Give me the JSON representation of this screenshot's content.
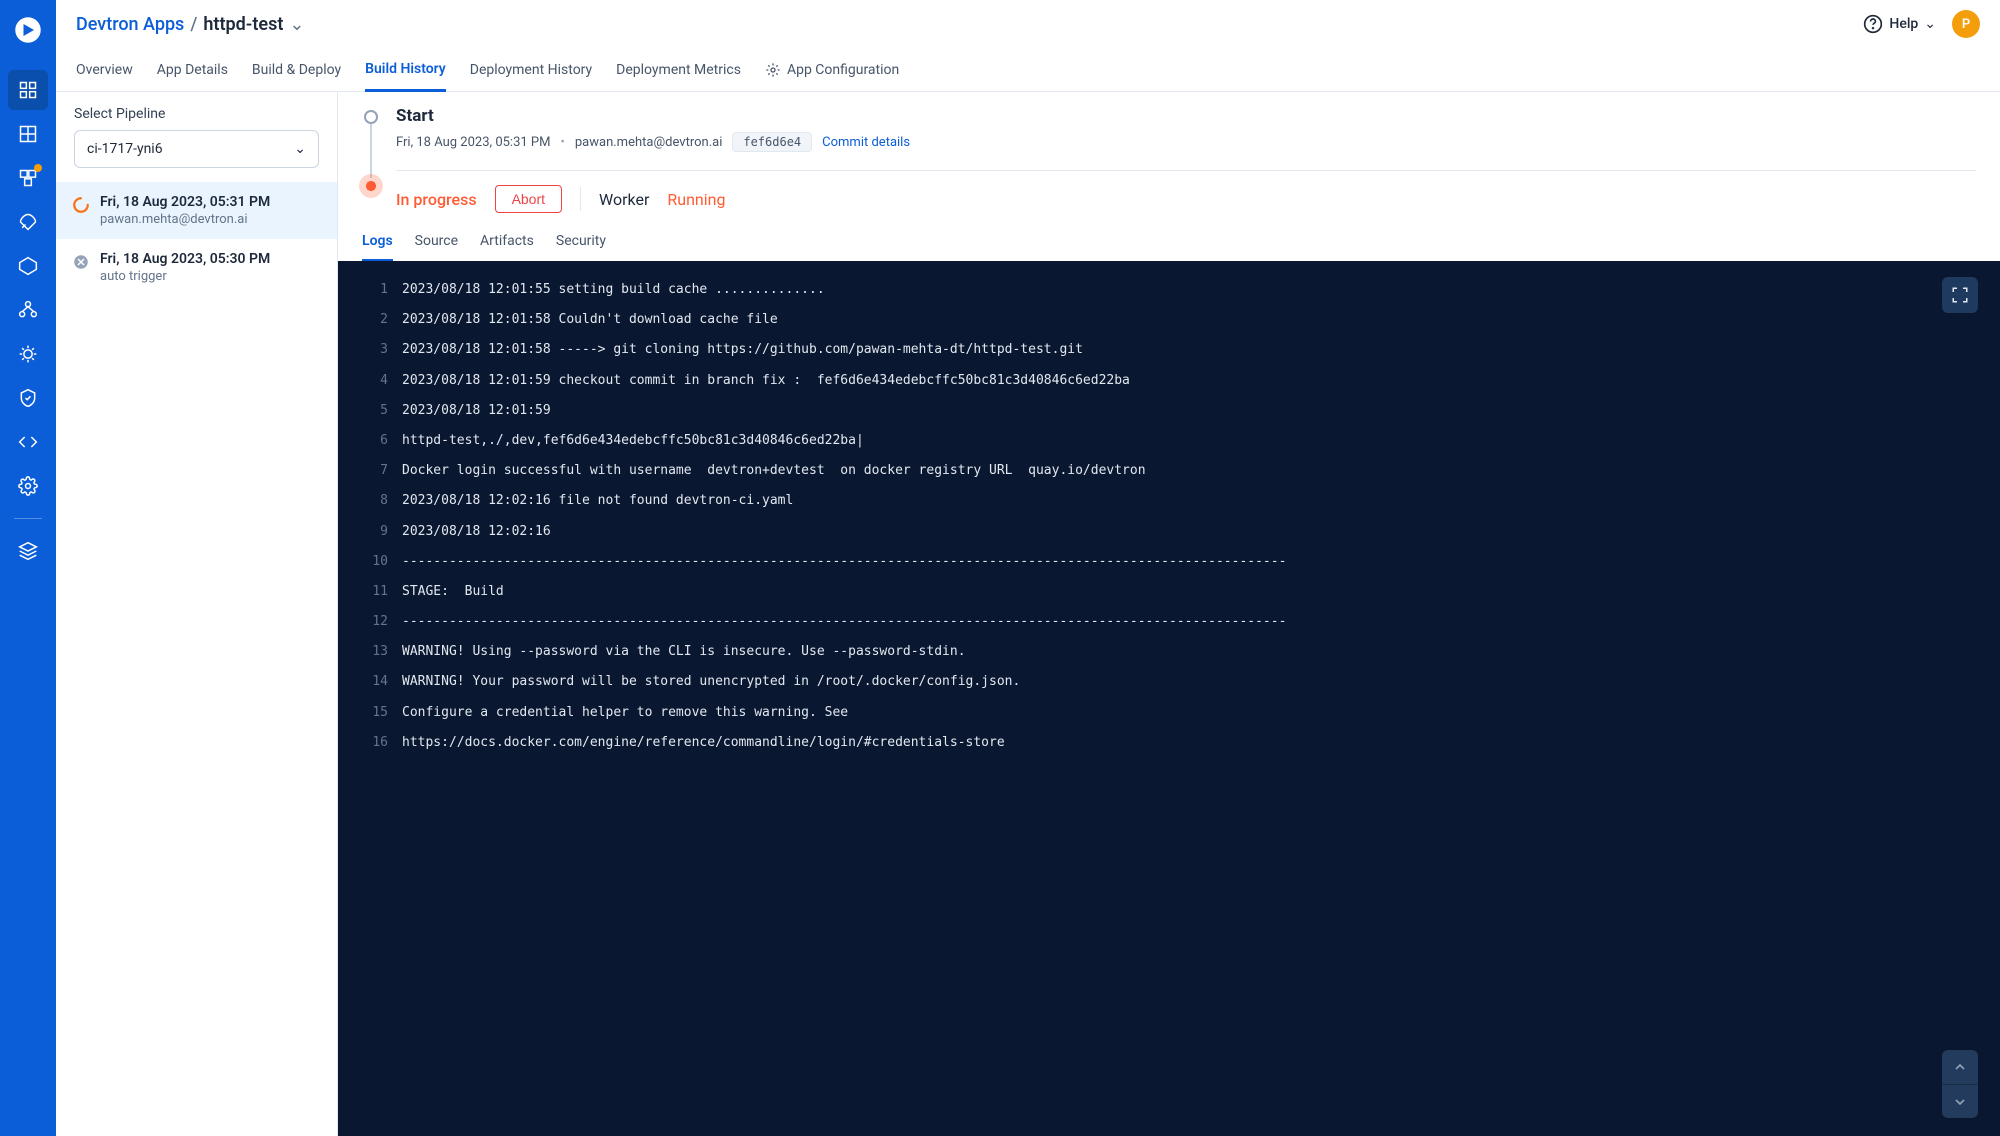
{
  "breadcrumb": {
    "seg1": "Devtron Apps",
    "sep": "/",
    "seg2": "httpd-test"
  },
  "help": {
    "label": "Help"
  },
  "avatar": {
    "initial": "P"
  },
  "tabs": [
    {
      "label": "Overview"
    },
    {
      "label": "App Details"
    },
    {
      "label": "Build & Deploy"
    },
    {
      "label": "Build History",
      "active": true
    },
    {
      "label": "Deployment History"
    },
    {
      "label": "Deployment Metrics"
    },
    {
      "label": "App Configuration",
      "gear": true
    }
  ],
  "pipeline": {
    "label": "Select Pipeline",
    "value": "ci-1717-yni6"
  },
  "builds": [
    {
      "status": "running",
      "title": "Fri, 18 Aug 2023, 05:31 PM",
      "sub": "pawan.mehta@devtron.ai",
      "active": true
    },
    {
      "status": "stopped",
      "title": "Fri, 18 Aug 2023, 05:30 PM",
      "sub": "auto trigger"
    }
  ],
  "detail": {
    "title": "Start",
    "timestamp": "Fri, 18 Aug 2023, 05:31 PM",
    "author": "pawan.mehta@devtron.ai",
    "commit": "fef6d6e4",
    "commit_link": "Commit details",
    "status": "In progress",
    "abort": "Abort",
    "worker_label": "Worker",
    "worker_status": "Running"
  },
  "subtabs": [
    {
      "label": "Logs",
      "active": true
    },
    {
      "label": "Source"
    },
    {
      "label": "Artifacts"
    },
    {
      "label": "Security"
    }
  ],
  "logs": [
    "2023/08/18 12:01:55 setting build cache ..............",
    "2023/08/18 12:01:58 Couldn't download cache file",
    "2023/08/18 12:01:58 -----> git cloning https://github.com/pawan-mehta-dt/httpd-test.git",
    "2023/08/18 12:01:59 checkout commit in branch fix :  fef6d6e434edebcffc50bc81c3d40846c6ed22ba",
    "2023/08/18 12:01:59",
    "httpd-test,./,dev,fef6d6e434edebcffc50bc81c3d40846c6ed22ba|",
    "Docker login successful with username  devtron+devtest  on docker registry URL  quay.io/devtron",
    "2023/08/18 12:02:16 file not found devtron-ci.yaml",
    "2023/08/18 12:02:16",
    "-----------------------------------------------------------------------------------------------------------------",
    "STAGE:  Build",
    "-----------------------------------------------------------------------------------------------------------------",
    "WARNING! Using --password via the CLI is insecure. Use --password-stdin.",
    "WARNING! Your password will be stored unencrypted in /root/.docker/config.json.",
    "Configure a credential helper to remove this warning. See",
    "https://docs.docker.com/engine/reference/commandline/login/#credentials-store"
  ]
}
